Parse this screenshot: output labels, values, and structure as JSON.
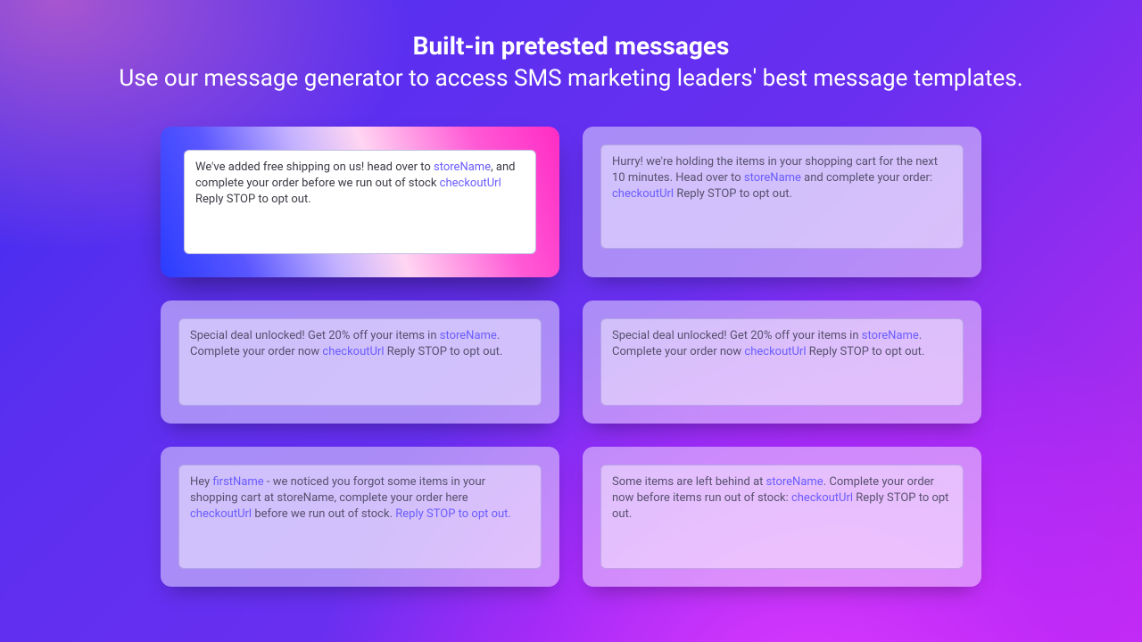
{
  "header": {
    "title": "Built-in pretested messages",
    "subtitle": "Use our message generator to access SMS marketing leaders' best message templates."
  },
  "cards": [
    {
      "selected": true,
      "segments": [
        {
          "t": "We've added free shipping on us! head over to ",
          "v": false
        },
        {
          "t": "storeName",
          "v": true
        },
        {
          "t": ", and complete your order before we run out of stock ",
          "v": false
        },
        {
          "t": "checkoutUrl",
          "v": true
        },
        {
          "t": " Reply STOP to opt out.",
          "v": false
        }
      ]
    },
    {
      "selected": false,
      "segments": [
        {
          "t": "Hurry! we're holding the items in your shopping cart for the next 10 minutes. Head over to ",
          "v": false
        },
        {
          "t": "storeName",
          "v": true
        },
        {
          "t": " and complete your order: ",
          "v": false
        },
        {
          "t": "checkoutUrl",
          "v": true
        },
        {
          "t": " Reply STOP to opt out.",
          "v": false
        }
      ]
    },
    {
      "selected": false,
      "segments": [
        {
          "t": "Special deal unlocked! Get 20% off your items in ",
          "v": false
        },
        {
          "t": "storeName",
          "v": true
        },
        {
          "t": ". Complete your order now ",
          "v": false
        },
        {
          "t": "checkoutUrl",
          "v": true
        },
        {
          "t": " Reply STOP to opt out.",
          "v": false
        }
      ]
    },
    {
      "selected": false,
      "segments": [
        {
          "t": "Special deal unlocked! Get 20% off your items in ",
          "v": false
        },
        {
          "t": "storeName",
          "v": true
        },
        {
          "t": ". Complete your order now ",
          "v": false
        },
        {
          "t": "checkoutUrl",
          "v": true
        },
        {
          "t": " Reply STOP to opt out.",
          "v": false
        }
      ]
    },
    {
      "selected": false,
      "segments": [
        {
          "t": "Hey ",
          "v": false
        },
        {
          "t": "firstName",
          "v": true
        },
        {
          "t": " - we noticed you forgot some items in your shopping cart at storeName, complete your order here ",
          "v": false
        },
        {
          "t": "checkoutUrl",
          "v": true
        },
        {
          "t": " before we run out of stock. ",
          "v": false
        },
        {
          "t": "Reply STOP to opt out.",
          "v": true
        }
      ]
    },
    {
      "selected": false,
      "segments": [
        {
          "t": "Some items are left behind at ",
          "v": false
        },
        {
          "t": "storeName",
          "v": true
        },
        {
          "t": ". Complete your order now before items run out of stock: ",
          "v": false
        },
        {
          "t": "checkoutUrl",
          "v": true
        },
        {
          "t": " Reply STOP to opt out.",
          "v": false
        }
      ]
    }
  ]
}
